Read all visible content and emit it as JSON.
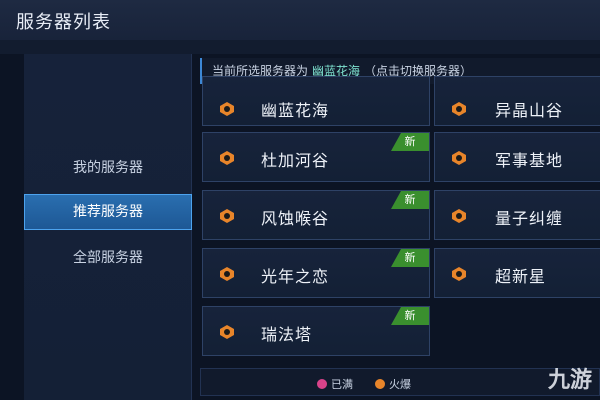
{
  "window": {
    "title": "服务器列表"
  },
  "sidebar": {
    "items": [
      {
        "label": "我的服务器",
        "active": false
      },
      {
        "label": "推荐服务器",
        "active": true
      },
      {
        "label": "全部服务器",
        "active": false
      }
    ]
  },
  "notice": {
    "prefix": "当前所选服务器为",
    "server": "幽蓝花海",
    "hint": "（点击切换服务器）"
  },
  "servers_left": [
    {
      "name": "幽蓝花海",
      "badge": ""
    },
    {
      "name": "杜加河谷",
      "badge": "新"
    },
    {
      "name": "风蚀喉谷",
      "badge": "新"
    },
    {
      "name": "光年之恋",
      "badge": "新"
    },
    {
      "name": "瑞法塔",
      "badge": "新"
    }
  ],
  "servers_right": [
    {
      "name": "异晶山谷",
      "badge": ""
    },
    {
      "name": "军事基地",
      "badge": ""
    },
    {
      "name": "量子纠缠",
      "badge": ""
    },
    {
      "name": "超新星",
      "badge": ""
    }
  ],
  "legend": [
    {
      "label": "已满",
      "color": "#d9438a"
    },
    {
      "label": "火爆",
      "color": "#e8852a"
    }
  ],
  "watermark": {
    "text": "九游"
  },
  "colors": {
    "accent": "#2a6fb0",
    "badge": "#3a8f2e",
    "highlight": "#7fe3d0"
  }
}
